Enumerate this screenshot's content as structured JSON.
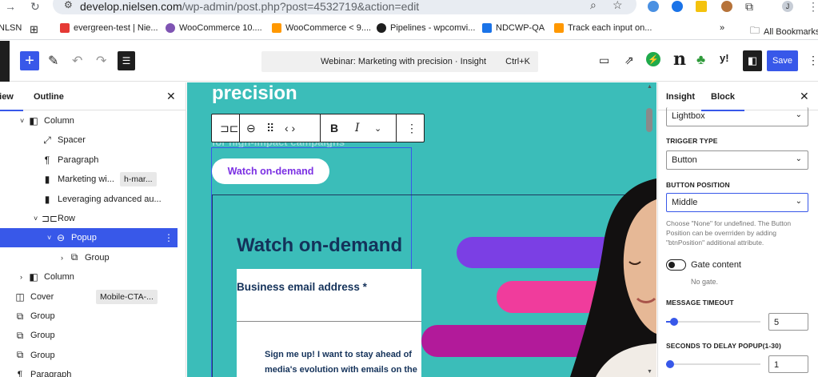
{
  "browser": {
    "url_domain": "develop.nielsen.com",
    "url_path": "/wp-admin/post.php?post=4532719&action=edit",
    "bookmarks": [
      {
        "label": "NLSN",
        "color": "#5f6368"
      },
      {
        "label": "",
        "color": "#5f6368"
      },
      {
        "label": "evergreen-test | Nie...",
        "color": "#e53935"
      },
      {
        "label": "WooCommerce 10....",
        "color": "#7f54b3"
      },
      {
        "label": "WooCommerce < 9....",
        "color": "#ff9800"
      },
      {
        "label": "Pipelines - wpcomvi...",
        "color": "#1e1e1e"
      },
      {
        "label": "NDCWP-QA",
        "color": "#1a73e8"
      },
      {
        "label": "Track each input on...",
        "color": "#ff9800"
      }
    ],
    "overflow": "»",
    "all_bookmarks": "All Bookmarks",
    "profile_initial": "J"
  },
  "editor": {
    "doc_title": "Webinar: Marketing with precision · Insight",
    "doc_shortcut": "Ctrl+K",
    "save_label": "Save",
    "plugin_n": "n"
  },
  "outline": {
    "tab_list": "View",
    "tab_outline": "Outline",
    "rows": [
      {
        "label": "Column",
        "icon": "columns-icon",
        "chevron": "˅",
        "depth": 1
      },
      {
        "label": "Spacer",
        "icon": "spacer-icon",
        "chevron": "",
        "depth": 2
      },
      {
        "label": "Paragraph",
        "icon": "paragraph-icon",
        "chevron": "",
        "depth": 2
      },
      {
        "label": "Marketing wi...",
        "icon": "bookmark-icon",
        "chevron": "",
        "depth": 2,
        "badge": "h-mar..."
      },
      {
        "label": "Leveraging advanced au...",
        "icon": "bookmark-icon",
        "chevron": "",
        "depth": 2
      },
      {
        "label": "Row",
        "icon": "row-icon",
        "chevron": "˅",
        "depth": 2
      },
      {
        "label": "Popup",
        "icon": "link-icon",
        "chevron": "˅",
        "depth": 3,
        "selected": true
      },
      {
        "label": "Group",
        "icon": "group-icon",
        "chevron": "›",
        "depth": 4
      },
      {
        "label": "Column",
        "icon": "columns-icon",
        "chevron": "›",
        "depth": 1
      },
      {
        "label": "Cover",
        "icon": "cover-icon",
        "chevron": "",
        "depth": 0,
        "badge": "Mobile-CTA-..."
      },
      {
        "label": "Group",
        "icon": "group-icon",
        "chevron": "",
        "depth": 0
      },
      {
        "label": "Group",
        "icon": "group-icon",
        "chevron": "",
        "depth": 0
      },
      {
        "label": "Group",
        "icon": "group-icon",
        "chevron": "",
        "depth": 0
      },
      {
        "label": "Paragraph",
        "icon": "paragraph-icon",
        "chevron": "",
        "depth": 0
      }
    ]
  },
  "canvas": {
    "heading_tail": "precision",
    "sub_heading_hidden": "for high-impact campaigns",
    "watch_button": "Watch on-demand",
    "form_title": "Watch on-demand",
    "email_label": "Business email address *",
    "consent_text": "Sign me up! I want to stay ahead of media's evolution with emails on the",
    "pill_colors": [
      "#7b3fe4",
      "#f03c9c",
      "#b21a9a"
    ]
  },
  "sidebar": {
    "tab_insight": "Insight",
    "tab_block": "Block",
    "lightbox_value": "Lightbox",
    "trigger_type_label": "TRIGGER TYPE",
    "trigger_type_value": "Button",
    "button_position_label": "BUTTON POSITION",
    "button_position_value": "Middle",
    "button_position_help": "Choose \"None\" for undefined. The Button Position can be overrriden by adding \"btnPosition\" additional attribute.",
    "gate_label": "Gate content",
    "gate_help": "No gate.",
    "gate_on": false,
    "message_timeout_label": "MESSAGE TIMEOUT",
    "message_timeout_value": "5",
    "message_timeout_level": 0.05,
    "delay_label": "SECONDS TO DELAY POPUP(1-30)",
    "delay_value": "1",
    "delay_level": 0.0
  }
}
